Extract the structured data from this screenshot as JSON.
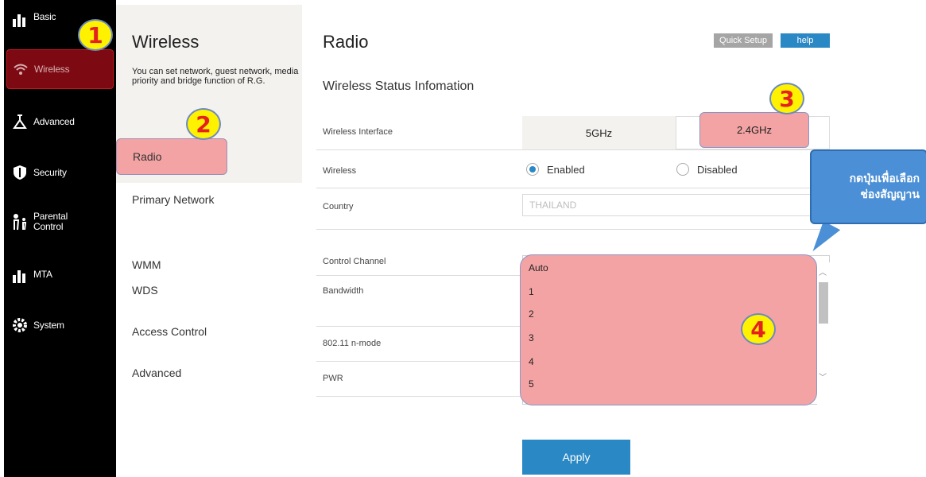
{
  "nav": {
    "items": [
      {
        "label": "Basic",
        "icon": "bar-chart-icon"
      },
      {
        "label": "Wireless",
        "icon": "wifi-icon",
        "active": true
      },
      {
        "label": "Advanced",
        "icon": "flask-icon"
      },
      {
        "label": "Security",
        "icon": "shield-icon"
      },
      {
        "label": "Parental",
        "label2": "Control",
        "icon": "family-icon"
      },
      {
        "label": "MTA",
        "icon": "bar-chart-icon"
      },
      {
        "label": "System",
        "icon": "gear-icon"
      }
    ]
  },
  "subnav": {
    "title": "Wireless",
    "description": "You can set network, guest network, media priority and bridge function of R.G.",
    "items": [
      "Radio",
      "Primary Network",
      "WMM",
      "WDS",
      "Access Control",
      "Advanced"
    ]
  },
  "header": {
    "title": "Radio",
    "quick_setup": "Quick Setup",
    "help": "help"
  },
  "main": {
    "section_title": "Wireless Status Infomation",
    "labels": {
      "interface": "Wireless Interface",
      "wireless": "Wireless",
      "country": "Country",
      "control_channel": "Control Channel",
      "bandwidth": "Bandwidth",
      "nmode": "802.11 n-mode",
      "pwr": "PWR"
    },
    "tabs": [
      "5GHz",
      "2.4GHz"
    ],
    "wireless_options": {
      "enabled": "Enabled",
      "disabled": "Disabled",
      "selected": "Enabled"
    },
    "country_value": "THAILAND",
    "control_channel_value": "1",
    "channel_options": [
      "Auto",
      "1",
      "2",
      "3",
      "4",
      "5"
    ],
    "apply": "Apply"
  },
  "annotations": {
    "badges": [
      "1",
      "2",
      "3",
      "4"
    ],
    "callout_line1": "กดปุ่มเพื่อเลือก",
    "callout_line2": "ช่องสัญญาน"
  },
  "colors": {
    "highlight": "#f4a3a4",
    "accent": "#2a88c5",
    "badge": "#fff200",
    "nav_active": "#7d0a13"
  }
}
